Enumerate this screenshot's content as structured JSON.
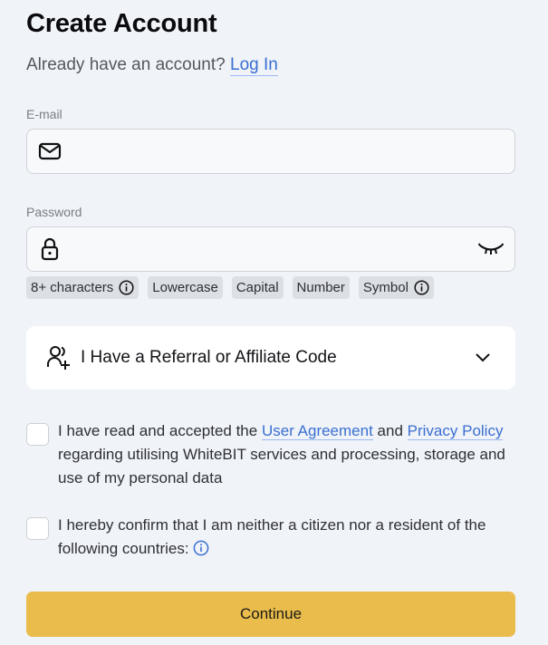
{
  "header": {
    "title": "Create Account",
    "subtitle_prefix": "Already have an account?",
    "login_link": "Log In"
  },
  "email": {
    "label": "E-mail",
    "value": "",
    "placeholder": "",
    "icon": "mail-icon"
  },
  "password": {
    "label": "Password",
    "value": "",
    "placeholder": "",
    "icon": "lock-icon",
    "toggle_icon": "eye-closed-icon",
    "requirements": [
      {
        "label": "8+ characters",
        "has_info": true
      },
      {
        "label": "Lowercase",
        "has_info": false
      },
      {
        "label": "Capital",
        "has_info": false
      },
      {
        "label": "Number",
        "has_info": false
      },
      {
        "label": "Symbol",
        "has_info": true
      }
    ]
  },
  "referral": {
    "label": "I Have a Referral or Affiliate Code",
    "icon": "add-user-icon",
    "expanded": false
  },
  "agreements": {
    "terms": {
      "checked": false,
      "text_before": "I have read and accepted the",
      "link1": "User Agreement",
      "text_middle": "and",
      "link2": "Privacy Policy",
      "text_after": "regarding utilising WhiteBIT services and processing, storage and use of my personal data"
    },
    "residency": {
      "checked": false,
      "text": "I hereby confirm that I am neither a citizen nor a resident of the following countries:"
    }
  },
  "actions": {
    "continue_label": "Continue"
  },
  "colors": {
    "background": "#f0f3f8",
    "link": "#3a6fd1",
    "primary_button": "#e9bc4c",
    "chip_bg": "#dcdfe4"
  }
}
